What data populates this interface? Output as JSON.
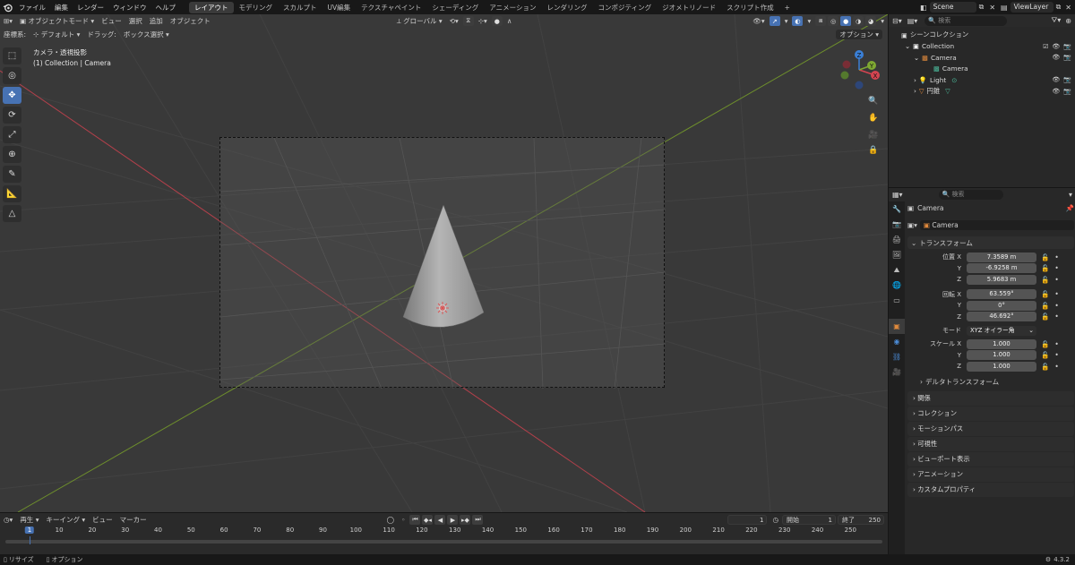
{
  "menu": {
    "items": [
      "ファイル",
      "編集",
      "レンダー",
      "ウィンドウ",
      "ヘルプ"
    ],
    "workspaces": [
      "レイアウト",
      "モデリング",
      "スカルプト",
      "UV編集",
      "テクスチャペイント",
      "シェーディング",
      "アニメーション",
      "レンダリング",
      "コンポジティング",
      "ジオメトリノード",
      "スクリプト作成"
    ],
    "add_tab": "+",
    "active_workspace": 0,
    "scene": "Scene",
    "view_layer": "ViewLayer"
  },
  "viewport": {
    "mode": "オブジェクトモード",
    "menus": [
      "ビュー",
      "選択",
      "追加",
      "オブジェクト"
    ],
    "orientation_label": "座標系:",
    "orientation": "デフォルト",
    "drag_label": "ドラッグ:",
    "drag": "ボックス選択",
    "transform_space": "グローバル",
    "options": "オプション",
    "view_name": "カメラ・透視投影",
    "context": "(1) Collection | Camera",
    "gizmo": {
      "x": "X",
      "y": "Y",
      "z": "Z"
    }
  },
  "outliner": {
    "search_placeholder": "検索",
    "root": "シーンコレクション",
    "items": [
      {
        "label": "Collection",
        "depth": 0
      },
      {
        "label": "Camera",
        "depth": 1
      },
      {
        "label": "Camera",
        "depth": 2
      },
      {
        "label": "Light",
        "depth": 1
      },
      {
        "label": "円錐",
        "depth": 1
      }
    ]
  },
  "properties": {
    "search_placeholder": "検索",
    "object_name": "Camera",
    "datablock": "Camera",
    "transform_title": "トランスフォーム",
    "location_label": "位置 X",
    "location": [
      "7.3589 m",
      "-6.9258 m",
      "5.9683 m"
    ],
    "rotation_label": "回転 X",
    "rotation": [
      "63.559°",
      "0°",
      "46.692°"
    ],
    "mode_label": "モード",
    "mode": "XYZ オイラー角",
    "scale_label": "スケール X",
    "scale": [
      "1.000",
      "1.000",
      "1.000"
    ],
    "axis_y": "Y",
    "axis_z": "Z",
    "delta": "デルタトランスフォーム",
    "sections": [
      "関係",
      "コレクション",
      "モーションパス",
      "可視性",
      "ビューポート表示",
      "アニメーション",
      "カスタムプロパティ"
    ]
  },
  "timeline": {
    "playback": "再生",
    "keying": "キーイング",
    "view": "ビュー",
    "marker": "マーカー",
    "current_frame": "1",
    "start_label": "開始",
    "start": "1",
    "end_label": "終了",
    "end": "250",
    "ticks": [
      "1",
      "10",
      "20",
      "30",
      "40",
      "50",
      "60",
      "70",
      "80",
      "90",
      "100",
      "110",
      "120",
      "130",
      "140",
      "150",
      "160",
      "170",
      "180",
      "190",
      "200",
      "210",
      "220",
      "230",
      "240",
      "250"
    ]
  },
  "status": {
    "left": "リサイズ",
    "center": "オプション",
    "version": "4.3.2"
  },
  "colors": {
    "accent": "#4772b3",
    "x_axis": "#d44450",
    "y_axis": "#7fa932",
    "z_axis": "#3a7fd6"
  }
}
